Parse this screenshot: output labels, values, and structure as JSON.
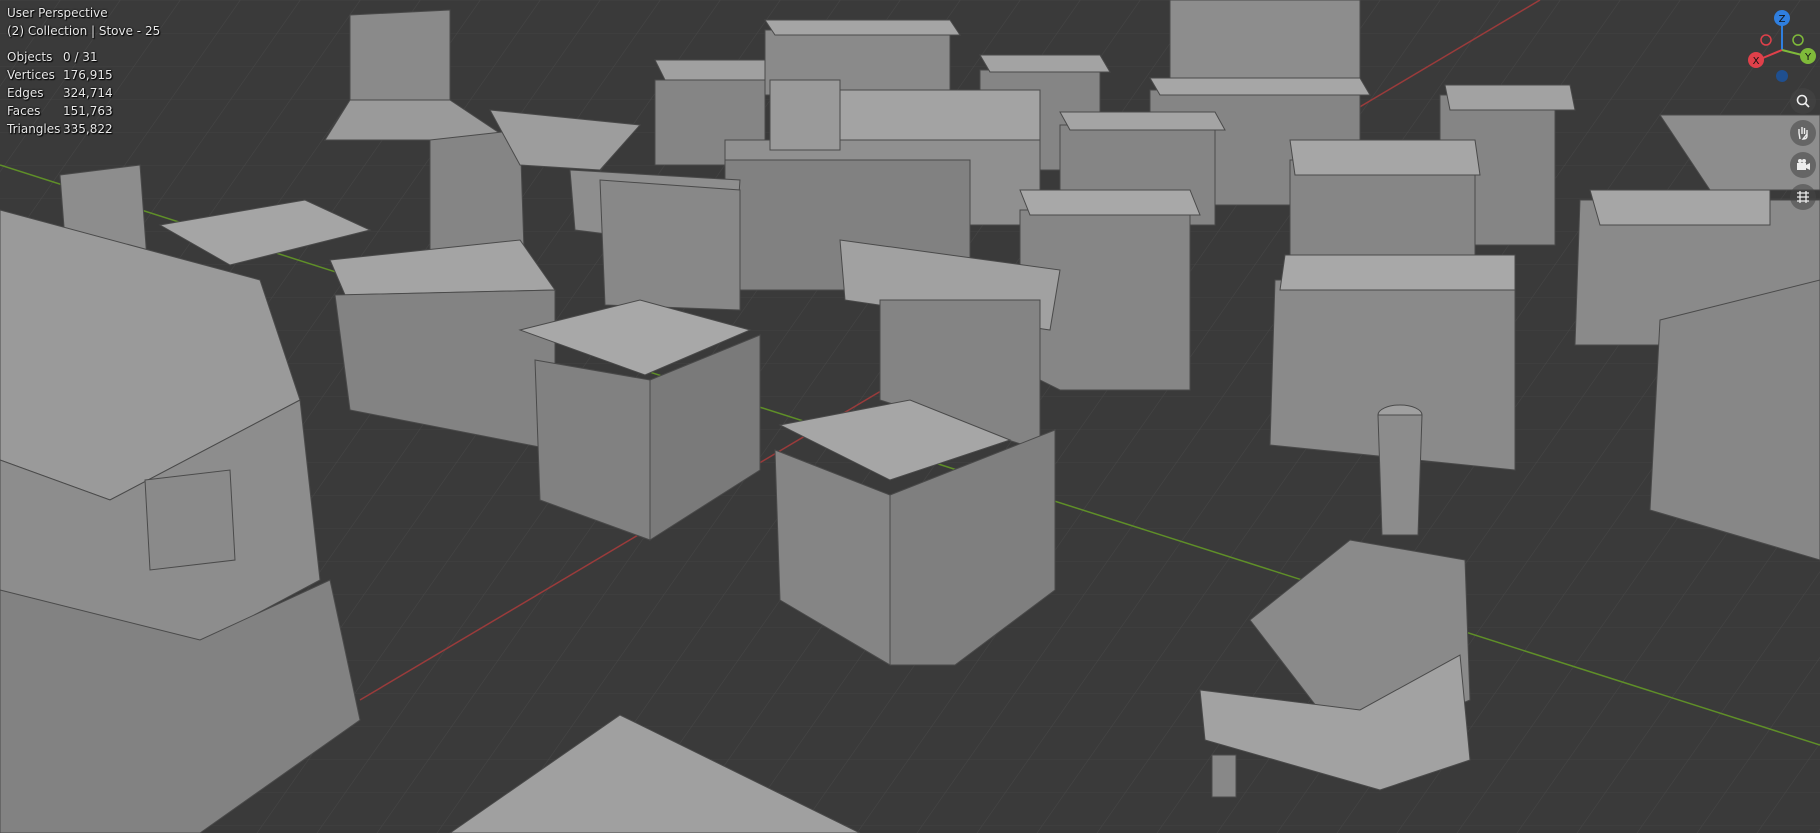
{
  "viewport": {
    "perspective_label": "User Perspective",
    "collection_label": "(2) Collection | Stove - 25",
    "stats": [
      {
        "label": "Objects",
        "value": "0 / 31"
      },
      {
        "label": "Vertices",
        "value": "176,915"
      },
      {
        "label": "Edges",
        "value": "324,714"
      },
      {
        "label": "Faces",
        "value": "151,763"
      },
      {
        "label": "Triangles",
        "value": "335,822"
      }
    ]
  },
  "gizmo": {
    "axes": [
      {
        "name": "Z",
        "color": "#2f7fe0"
      },
      {
        "name": "Y",
        "color": "#7fba3a"
      },
      {
        "name": "X",
        "color": "#e0404a"
      }
    ]
  },
  "nav_buttons": [
    "zoom-icon",
    "hand-pan-icon",
    "camera-icon",
    "grid-view-icon"
  ],
  "colors": {
    "background": "#3a3a3a",
    "grid": "#4a4a4a",
    "x_axis": "#a63a3a",
    "y_axis": "#6a9a2a",
    "model": "#8c8c8c"
  }
}
